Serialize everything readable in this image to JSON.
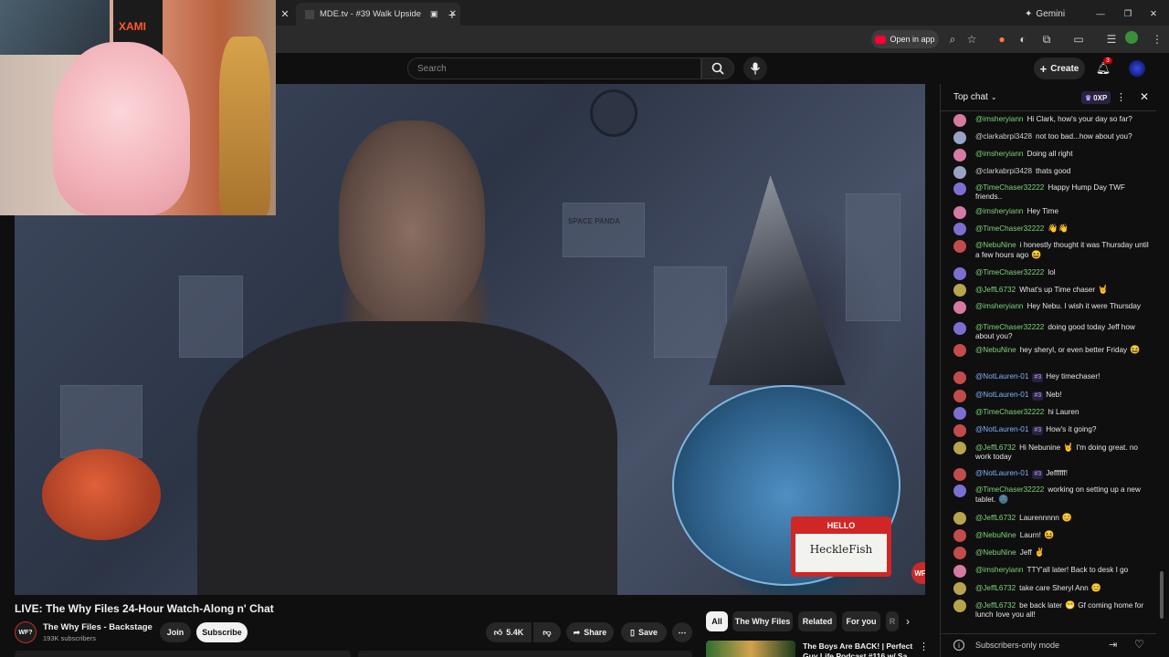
{
  "browser": {
    "tab_title": "MDE.tv - #39 Walk Upside",
    "gemini_label": "Gemini",
    "open_in_app": "Open in app"
  },
  "youtube": {
    "search_placeholder": "Search",
    "create_label": "Create",
    "notification_count": "3"
  },
  "video": {
    "watermark": "WF?",
    "sign_text_1": "HELLO",
    "sign_text_2": "HeckleFish",
    "wall_text": "SPACE PANDA",
    "webcam_text": "XAMI"
  },
  "chat": {
    "header_label": "Top chat",
    "xp_label": "0XP",
    "footer_label": "Subscribers-only mode",
    "messages": [
      {
        "author": "@imsheryiann",
        "text": "Hi Clark, how's your day so far?",
        "color": "#7fd37a",
        "avatar": "#d67aa3"
      },
      {
        "author": "@clarkabrpi3428",
        "text": "not too bad...how about you?",
        "color": "#cfcfcf",
        "avatar": "#9aa2c5"
      },
      {
        "author": "@imsheryiann",
        "text": "Doing all right",
        "color": "#7fd37a",
        "avatar": "#d67aa3"
      },
      {
        "author": "@clarkabrpi3428",
        "text": "thats good",
        "color": "#cfcfcf",
        "avatar": "#9aa2c5"
      },
      {
        "author": "@TimeChaser32222",
        "text": "Happy Hump Day TWF friends..",
        "color": "#7fd37a",
        "avatar": "#7c6fd1"
      },
      {
        "author": "@imsheryiann",
        "text": "Hey Time",
        "color": "#7fd37a",
        "avatar": "#d67aa3"
      },
      {
        "author": "@TimeChaser32222",
        "text": "",
        "emoji": "👋👋",
        "color": "#7fd37a",
        "avatar": "#7c6fd1"
      },
      {
        "author": "@NebuNine",
        "text": "i honestly thought it was Thursday until a few hours ago",
        "emoji": "😆",
        "color": "#7fd37a",
        "avatar": "#c24b4b"
      },
      {
        "author": "@TimeChaser32222",
        "text": "lol",
        "color": "#7fd37a",
        "avatar": "#7c6fd1"
      },
      {
        "author": "@JeffL6732",
        "text": "What's up Time chaser",
        "emoji": "🤘",
        "color": "#7fd37a",
        "avatar": "#b8a44c"
      },
      {
        "author": "@imsheryiann",
        "text": "Hey Nebu. I wish it were Thursday",
        "color": "#7fd37a",
        "avatar": "#d67aa3"
      },
      {
        "author": "@TimeChaser32222",
        "text": "doing good today Jeff how about you?",
        "color": "#7fd37a",
        "avatar": "#7c6fd1"
      },
      {
        "author": "@NebuNine",
        "text": "hey sheryl, or even better Friday",
        "emoji": "😆",
        "color": "#7fd37a",
        "avatar": "#c24b4b"
      },
      {
        "author": "@NotLauren-01",
        "badge": "#3",
        "text": "Hey timechaser!",
        "color": "#7fb0ff",
        "avatar": "#c24b4b"
      },
      {
        "author": "@NotLauren-01",
        "badge": "#3",
        "text": "Neb!",
        "color": "#7fb0ff",
        "avatar": "#c24b4b"
      },
      {
        "author": "@TimeChaser32222",
        "text": "hi Lauren",
        "color": "#7fd37a",
        "avatar": "#7c6fd1"
      },
      {
        "author": "@NotLauren-01",
        "badge": "#3",
        "text": "How's it going?",
        "color": "#7fb0ff",
        "avatar": "#c24b4b"
      },
      {
        "author": "@JeffL6732",
        "text": "Hi Nebunine",
        "emoji": "🤘",
        "text2": "I'm doing great. no work today",
        "color": "#7fd37a",
        "avatar": "#b8a44c"
      },
      {
        "author": "@NotLauren-01",
        "badge": "#3",
        "text": "Jeffffff!",
        "color": "#7fb0ff",
        "avatar": "#c24b4b"
      },
      {
        "author": "@TimeChaser32222",
        "text": "working on setting up a new tablet.",
        "emoji": "🌚",
        "color": "#7fd37a",
        "avatar": "#7c6fd1"
      },
      {
        "author": "@JeffL6732",
        "text": "Laurennnnn",
        "emoji": "😊",
        "color": "#7fd37a",
        "avatar": "#b8a44c"
      },
      {
        "author": "@NebuNine",
        "text": "Laurn!",
        "emoji": "😆",
        "color": "#7fd37a",
        "avatar": "#c24b4b"
      },
      {
        "author": "@NebuNine",
        "text": "Jeff",
        "emoji": "✌",
        "color": "#7fd37a",
        "avatar": "#c24b4b"
      },
      {
        "author": "@imsheryiann",
        "text": "TTY'all later! Back to desk I go",
        "color": "#7fd37a",
        "avatar": "#d67aa3"
      },
      {
        "author": "@JeffL6732",
        "text": "take care Sheryl Ann",
        "emoji": "😊",
        "color": "#7fd37a",
        "avatar": "#b8a44c"
      },
      {
        "author": "@JeffL6732",
        "text": "be back later",
        "emoji": "😁",
        "text2": "Gf coming home for lunch",
        "text3": "love you all!",
        "color": "#7fd37a",
        "avatar": "#b8a44c"
      }
    ]
  },
  "below": {
    "title": "LIVE: The Why Files 24-Hour Watch-Along n' Chat",
    "channel_name": "The Why Files - Backstage",
    "subscribers": "193K subscribers",
    "channel_logo": "WF?",
    "join_label": "Join",
    "subscribe_label": "Subscribe",
    "likes": "5.4K",
    "share_label": "Share",
    "save_label": "Save",
    "chips": [
      "All",
      "The Why Files",
      "Related",
      "For you",
      "R"
    ],
    "rec_title_1": "The Boys Are BACK! | Perfect",
    "rec_title_2": "Guy Life Podcast #116 w/ Sa..."
  },
  "colors": {
    "accent_red": "#ff0033",
    "chat_green": "#7fd37a",
    "background": "#0f0f0f"
  }
}
